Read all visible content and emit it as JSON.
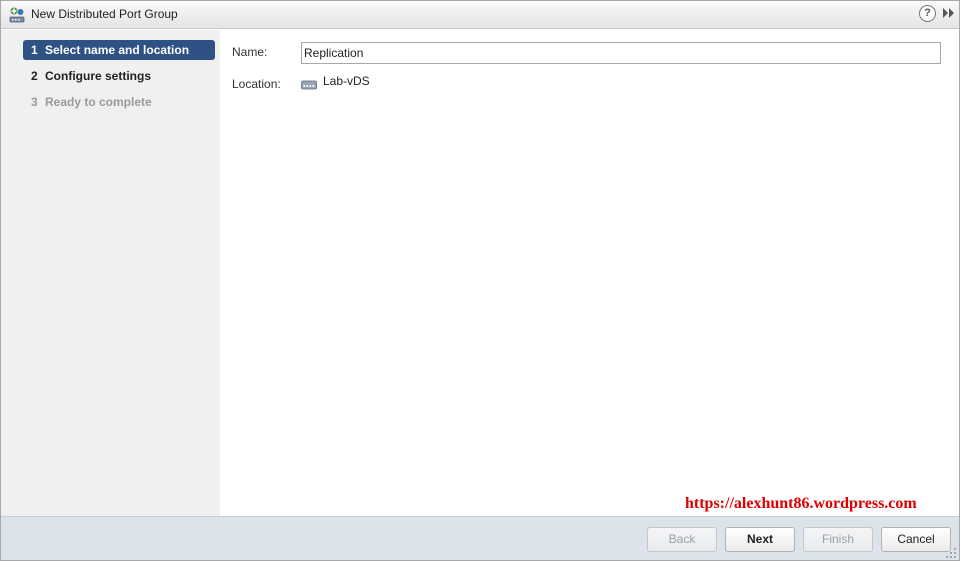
{
  "window": {
    "title": "New Distributed Port Group",
    "help_glyph": "?"
  },
  "steps": [
    {
      "num": "1",
      "label": "Select name and location",
      "state": "active"
    },
    {
      "num": "2",
      "label": "Configure settings",
      "state": "normal"
    },
    {
      "num": "3",
      "label": "Ready to complete",
      "state": "disabled"
    }
  ],
  "form": {
    "name_label": "Name:",
    "name_value": "Replication",
    "location_label": "Location:",
    "location_value": "Lab-vDS"
  },
  "watermark": "https://alexhunt86.wordpress.com",
  "footer": {
    "back_label": "Back",
    "next_label": "Next",
    "finish_label": "Finish",
    "cancel_label": "Cancel"
  },
  "colors": {
    "active_step": "#2e5283",
    "watermark": "#e00000",
    "footer_bg": "#dde3ea"
  }
}
